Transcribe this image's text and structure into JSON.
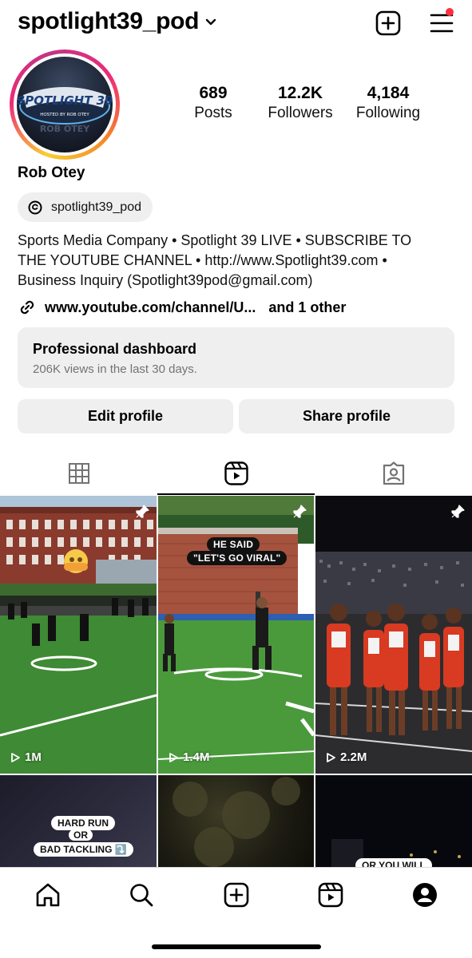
{
  "header": {
    "username": "spotlight39_pod",
    "add_icon": "plus-square-icon",
    "menu_icon": "hamburger-menu-icon"
  },
  "profile": {
    "avatar_text_main": "SPOTLIGHT 39",
    "avatar_text_sub": "HOSTED BY ROB OTEY",
    "avatar_text_bottom": "ROB OTEY",
    "stats": [
      {
        "value": "689",
        "label": "Posts"
      },
      {
        "value": "12.2K",
        "label": "Followers"
      },
      {
        "value": "4,184",
        "label": "Following"
      }
    ],
    "full_name": "Rob Otey",
    "threads_handle": "spotlight39_pod",
    "bio_lines": [
      "Sports Media Company • Spotlight 39 LIVE • SUBSCRIBE TO",
      "THE YOUTUBE CHANNEL • http://www.Spotlight39.com •",
      "Business Inquiry (Spotlight39pod@gmail.com)"
    ],
    "link_text": "www.youtube.com/channel/U...",
    "link_other": "and 1 other"
  },
  "dashboard": {
    "title": "Professional dashboard",
    "subtitle": "206K views in the last 30 days."
  },
  "buttons": {
    "edit": "Edit profile",
    "share": "Share profile"
  },
  "tabs": {
    "items": [
      "grid-icon",
      "reels-icon",
      "tagged-icon"
    ],
    "active": 1
  },
  "grid": {
    "posts": [
      {
        "views": "1M",
        "pinned": true,
        "caption": ""
      },
      {
        "views": "1.4M",
        "pinned": true,
        "caption_1": "HE SAID",
        "caption_2": "\"LET'S GO VIRAL\""
      },
      {
        "views": "2.2M",
        "pinned": true,
        "caption": ""
      },
      {
        "caption_1": "HARD RUN",
        "caption_2": "OR",
        "caption_3": "BAD TACKLING ⤵️"
      },
      {
        "caption": ""
      },
      {
        "caption": "OR YOU WILL"
      }
    ]
  },
  "bottom_nav": {
    "items": [
      "home-icon",
      "search-icon",
      "create-icon",
      "reels-icon",
      "profile-icon"
    ]
  },
  "colors": {
    "accent_red": "#ff3040",
    "chip_bg": "#efefef",
    "muted_text": "#737373"
  }
}
